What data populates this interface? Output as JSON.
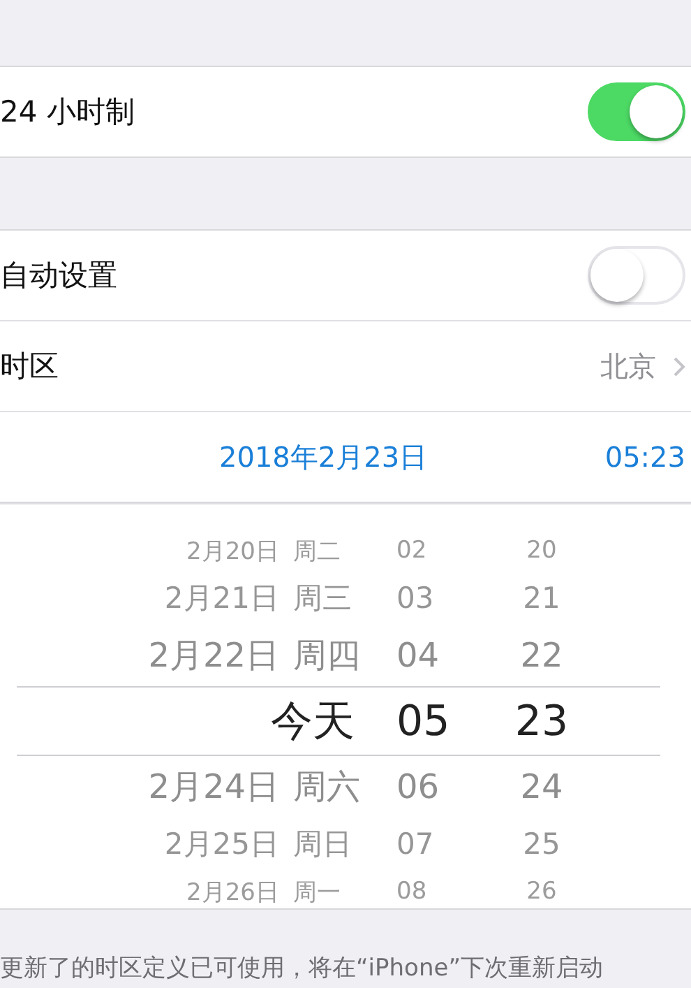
{
  "sections": [
    {
      "rows": [
        {
          "kind": "toggle",
          "label": "24 小时制",
          "on": true
        }
      ]
    },
    {
      "rows": [
        {
          "kind": "toggle",
          "label": "自动设置",
          "on": false
        },
        {
          "kind": "link",
          "label": "时区",
          "value": "北京"
        },
        {
          "kind": "datetime",
          "date": "2018年2月23日",
          "time": "05:23"
        }
      ]
    }
  ],
  "picker": {
    "rows": [
      {
        "date": "2月20日",
        "weekday": "周二",
        "hour": "02",
        "minute": "20",
        "selected": false
      },
      {
        "date": "2月21日",
        "weekday": "周三",
        "hour": "03",
        "minute": "21",
        "selected": false
      },
      {
        "date": "2月22日",
        "weekday": "周四",
        "hour": "04",
        "minute": "22",
        "selected": false
      },
      {
        "date": "今天",
        "hour": "05",
        "minute": "23",
        "selected": true
      },
      {
        "date": "2月24日",
        "weekday": "周六",
        "hour": "06",
        "minute": "24",
        "selected": false
      },
      {
        "date": "2月25日",
        "weekday": "周日",
        "hour": "07",
        "minute": "25",
        "selected": false
      },
      {
        "date": "2月26日",
        "weekday": "周一",
        "hour": "08",
        "minute": "26",
        "selected": false
      }
    ]
  },
  "footer": "更新了的时区定义已可使用，将在“iPhone”下次重新启动"
}
